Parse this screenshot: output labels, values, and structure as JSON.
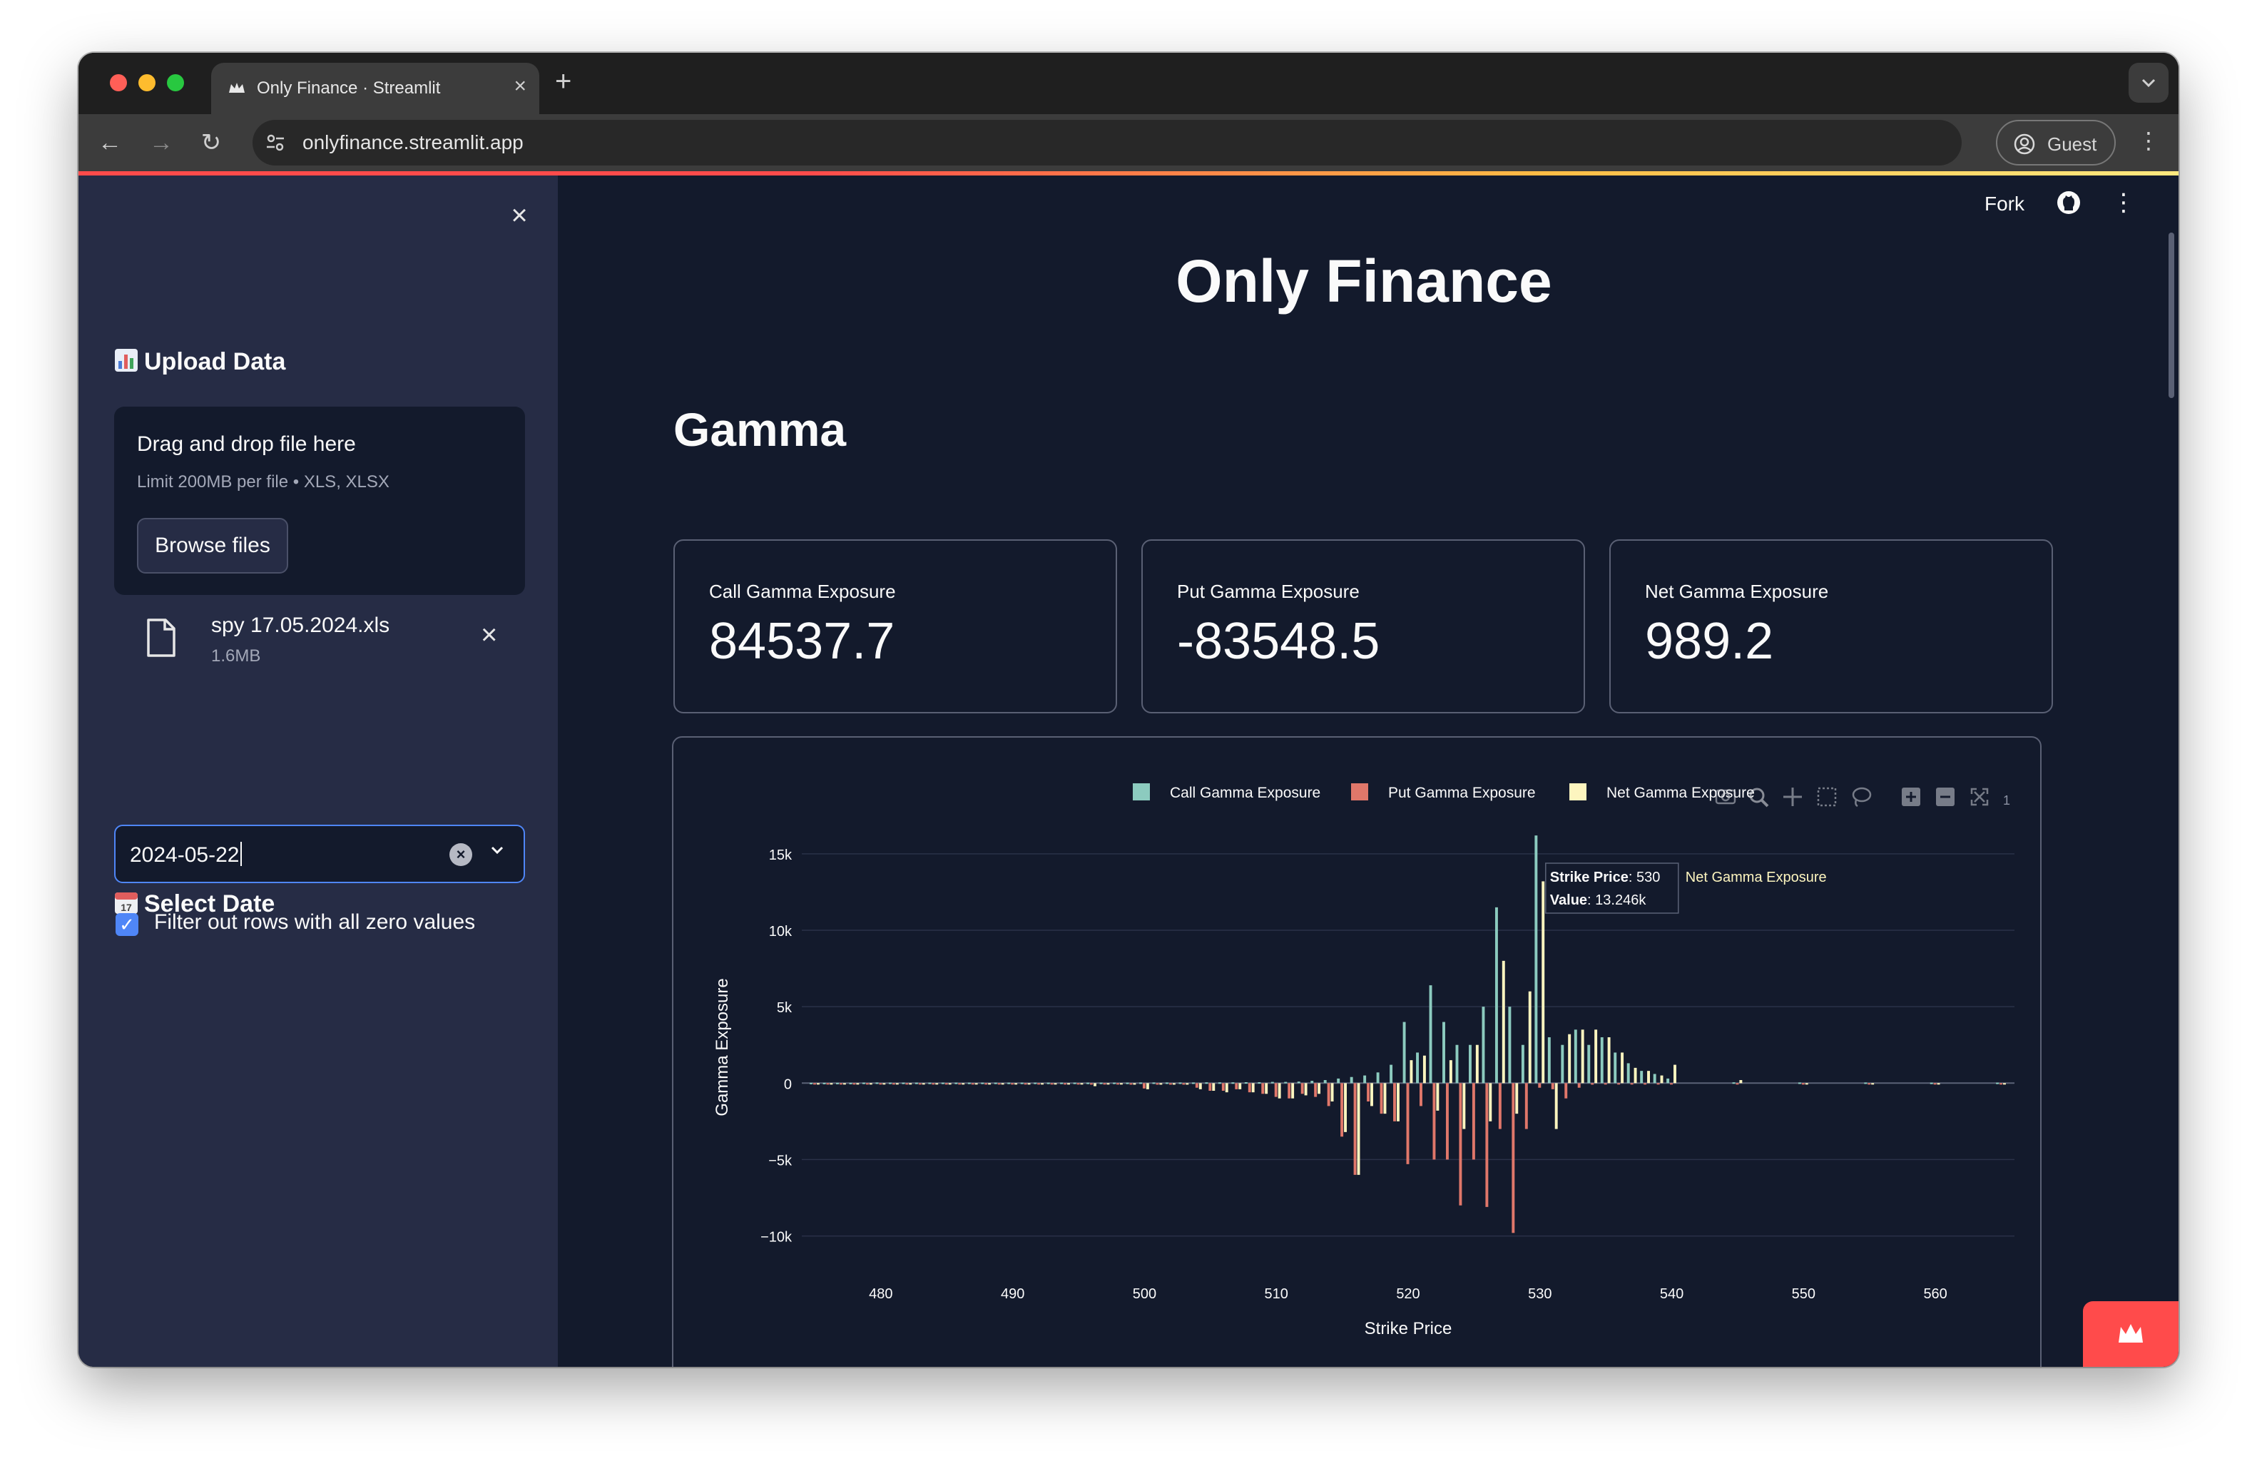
{
  "browser": {
    "tab_title": "Only Finance · Streamlit",
    "url": "onlyfinance.streamlit.app",
    "profile_label": "Guest"
  },
  "header": {
    "fork_label": "Fork"
  },
  "sidebar": {
    "upload_heading": "Upload Data",
    "dropzone_title": "Drag and drop file here",
    "dropzone_subtitle": "Limit 200MB per file • XLS, XLSX",
    "browse_label": "Browse files",
    "file_name": "spy 17.05.2024.xls",
    "file_size": "1.6MB",
    "date_heading": "Select Date",
    "date_value": "2024-05-22",
    "filter_label": "Filter out rows with all zero values",
    "filter_checked": true
  },
  "main": {
    "page_title": "Only Finance",
    "section_title": "Gamma",
    "metrics": [
      {
        "label": "Call Gamma Exposure",
        "value": "84537.7"
      },
      {
        "label": "Put Gamma Exposure",
        "value": "-83548.5"
      },
      {
        "label": "Net Gamma Exposure",
        "value": "989.2"
      }
    ]
  },
  "colors": {
    "call": "#8ccbbf",
    "put": "#e0776a",
    "net": "#fdf5bf",
    "accent": "#ff4b4b",
    "input_focus": "#4f86f7"
  },
  "chart_data": {
    "type": "bar",
    "xlabel": "Strike Price",
    "ylabel": "Gamma Exposure",
    "xlim": [
      474,
      566
    ],
    "ylim": [
      -11000,
      17000
    ],
    "xticks": [
      480,
      490,
      500,
      510,
      520,
      530,
      540,
      550,
      560
    ],
    "xtick_labels": [
      "480",
      "490",
      "500",
      "510",
      "520",
      "530",
      "540",
      "550",
      "560"
    ],
    "yticks": [
      -10000,
      -5000,
      0,
      5000,
      10000,
      15000
    ],
    "ytick_labels": [
      "−10k",
      "−5k",
      "0",
      "5k",
      "10k",
      "15k"
    ],
    "legend_position": "top-right",
    "strikes": [
      475,
      476,
      477,
      478,
      479,
      480,
      481,
      482,
      483,
      484,
      485,
      486,
      487,
      488,
      489,
      490,
      491,
      492,
      493,
      494,
      495,
      496,
      497,
      498,
      499,
      500,
      501,
      502,
      503,
      504,
      505,
      506,
      507,
      508,
      509,
      510,
      511,
      512,
      513,
      514,
      515,
      516,
      517,
      518,
      519,
      520,
      521,
      522,
      523,
      524,
      525,
      526,
      527,
      528,
      529,
      530,
      531,
      532,
      533,
      534,
      535,
      536,
      537,
      538,
      539,
      540,
      545,
      550,
      555,
      560,
      565
    ],
    "series": [
      {
        "name": "Call Gamma Exposure",
        "values": [
          20,
          20,
          20,
          20,
          30,
          40,
          30,
          30,
          30,
          30,
          30,
          30,
          30,
          30,
          30,
          30,
          30,
          30,
          30,
          30,
          30,
          30,
          30,
          30,
          30,
          40,
          40,
          40,
          40,
          40,
          50,
          50,
          50,
          60,
          60,
          80,
          80,
          100,
          150,
          200,
          300,
          400,
          500,
          700,
          1200,
          4000,
          2000,
          6400,
          4000,
          2500,
          2500,
          5000,
          11500,
          5000,
          2500,
          16200,
          3000,
          2500,
          3500,
          2500,
          3000,
          2000,
          1300,
          800,
          600,
          300,
          50,
          40,
          40,
          30,
          30
        ]
      },
      {
        "name": "Put Gamma Exposure",
        "values": [
          -20,
          -20,
          -20,
          -20,
          -30,
          -40,
          -30,
          -30,
          -30,
          -30,
          -30,
          -30,
          -30,
          -30,
          -30,
          -30,
          -30,
          -30,
          -30,
          -30,
          -30,
          -100,
          -50,
          -40,
          -100,
          -350,
          -100,
          -100,
          -100,
          -300,
          -500,
          -500,
          -400,
          -600,
          -700,
          -900,
          -1000,
          -700,
          -900,
          -1500,
          -3500,
          -6000,
          -1200,
          -2000,
          -2500,
          -5300,
          -1500,
          -5000,
          -5000,
          -8000,
          -5000,
          -8100,
          -3000,
          -9800,
          -3000,
          -300,
          -400,
          -1000,
          -300,
          -100,
          -50,
          -50,
          -40,
          -30,
          -20,
          -20,
          -50,
          -40,
          -40,
          -30,
          -30
        ]
      },
      {
        "name": "Net Gamma Exposure",
        "values": [
          -20,
          -20,
          -20,
          -20,
          -20,
          -40,
          -20,
          -20,
          -20,
          -20,
          -20,
          -20,
          -20,
          -20,
          -20,
          -50,
          -20,
          -20,
          -20,
          -20,
          -20,
          -200,
          -20,
          -20,
          -100,
          -400,
          -100,
          -100,
          -100,
          -400,
          -500,
          -600,
          -400,
          -600,
          -700,
          -1000,
          -1000,
          -800,
          -700,
          -1200,
          -3200,
          -6000,
          -1500,
          -2000,
          -2500,
          1500,
          1800,
          -1800,
          1500,
          -3000,
          2500,
          -2500,
          8000,
          -2000,
          6000,
          13200,
          -3000,
          3200,
          3500,
          3500,
          3000,
          2000,
          1000,
          800,
          500,
          1200,
          200,
          -40,
          -40,
          -30,
          -30
        ]
      }
    ],
    "tooltip": {
      "strike_key": "Strike Price",
      "strike_value": "530",
      "value_key": "Value",
      "value_value": "13.246k",
      "series_label": "Net Gamma Exposure"
    },
    "modebar_extra": "1"
  }
}
